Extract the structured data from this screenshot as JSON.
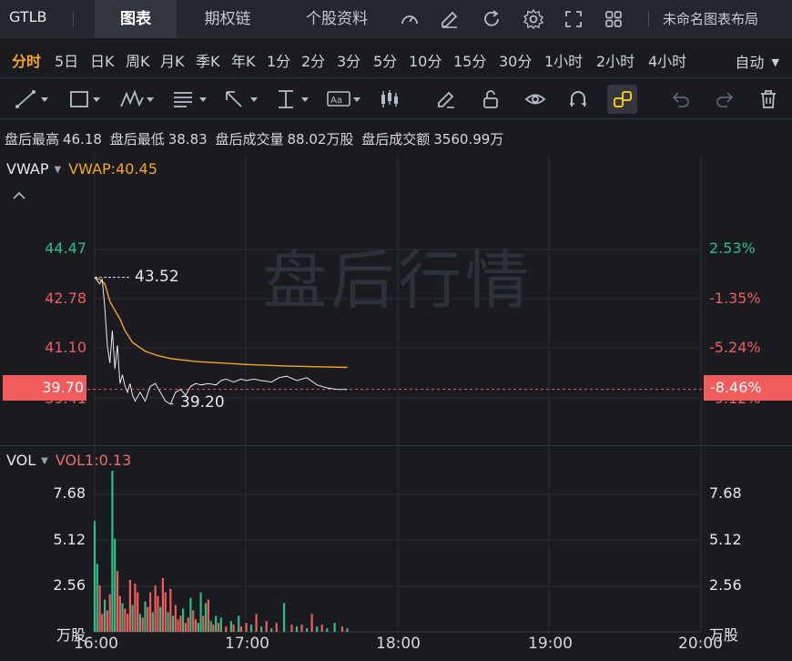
{
  "header": {
    "ticker": "GTLB",
    "tabs": [
      "图表",
      "期权链",
      "个股资料"
    ],
    "layout_name": "未命名图表布局"
  },
  "periods": {
    "items": [
      "分时",
      "5日",
      "日K",
      "周K",
      "月K",
      "季K",
      "年K",
      "1分",
      "2分",
      "3分",
      "5分",
      "10分",
      "15分",
      "30分",
      "1小时",
      "2小时",
      "4小时"
    ],
    "active": "分时",
    "auto_label": "自动"
  },
  "info": {
    "high_label": "盘后最高",
    "high": "46.18",
    "low_label": "盘后最低",
    "low": "38.83",
    "vol_label": "盘后成交量",
    "vol": "88.02万股",
    "amt_label": "盘后成交额",
    "amt": "3560.99万"
  },
  "price_panel": {
    "indicator": "VWAP",
    "indicator_value": "VWAP:40.45",
    "watermark": "盘后行情",
    "left_ticks": [
      "44.47",
      "42.78",
      "41.10",
      "39.41"
    ],
    "right_ticks": [
      "2.53%",
      "-1.35%",
      "-5.24%",
      "-9.12%"
    ],
    "current_price": "39.70",
    "current_pct": "-8.46%",
    "high_annotation": "43.52",
    "low_annotation": "39.20"
  },
  "volume_panel": {
    "indicator": "VOL",
    "indicator_value": "VOL1:0.13",
    "ticks": [
      "7.68",
      "5.12",
      "2.56"
    ],
    "unit": "万股"
  },
  "x_axis": {
    "labels": [
      "16:00",
      "17:00",
      "18:00",
      "19:00",
      "20:00"
    ]
  },
  "colors": {
    "up": "#2ebd85",
    "down": "#f05b5b",
    "vwap": "#f5a623",
    "accent": "#f5a623",
    "active_tool": "#f5c518"
  },
  "chart_data": [
    {
      "type": "line",
      "x_range": [
        "16:00",
        "20:00"
      ],
      "ylim": [
        38.9,
        45.8
      ],
      "series": [
        {
          "name": "VWAP",
          "x_minutes": [
            0,
            2,
            4,
            6,
            8,
            10,
            12,
            15,
            20,
            25,
            30,
            40,
            50,
            60,
            75,
            90,
            100
          ],
          "values": [
            43.5,
            43.45,
            43.3,
            42.7,
            42.4,
            42.1,
            41.7,
            41.3,
            41.0,
            40.85,
            40.75,
            40.65,
            40.6,
            40.55,
            40.5,
            40.47,
            40.45
          ]
        },
        {
          "name": "Price",
          "x_minutes": [
            0,
            2,
            3,
            4,
            5,
            6,
            7,
            8,
            9,
            10,
            11,
            12,
            13,
            14,
            15,
            16,
            18,
            20,
            22,
            24,
            26,
            28,
            30,
            32,
            34,
            36,
            38,
            40,
            42,
            45,
            48,
            50,
            52,
            55,
            58,
            60,
            63,
            66,
            70,
            73,
            76,
            80,
            84,
            88,
            92,
            96,
            100
          ],
          "values": [
            43.52,
            43.3,
            43.45,
            42.5,
            41.2,
            40.6,
            41.7,
            40.4,
            41.2,
            39.9,
            40.2,
            39.8,
            39.6,
            39.9,
            39.5,
            39.3,
            39.6,
            39.3,
            39.8,
            39.9,
            39.6,
            39.3,
            39.2,
            39.6,
            39.7,
            39.5,
            39.8,
            39.9,
            39.85,
            39.9,
            39.85,
            40.0,
            40.05,
            39.95,
            40.05,
            40.0,
            40.05,
            40.0,
            39.95,
            40.1,
            40.15,
            40.0,
            40.1,
            39.85,
            39.75,
            39.7,
            39.7
          ]
        }
      ]
    },
    {
      "type": "bar",
      "x_range": [
        "16:00",
        "20:00"
      ],
      "ylim": [
        0,
        9.6
      ],
      "unit": "万股",
      "x_minutes": [
        0,
        1,
        2,
        3,
        4,
        5,
        6,
        7,
        8,
        9,
        10,
        11,
        12,
        13,
        14,
        15,
        16,
        17,
        18,
        19,
        20,
        21,
        22,
        23,
        24,
        25,
        26,
        27,
        28,
        29,
        30,
        31,
        32,
        33,
        34,
        35,
        36,
        37,
        38,
        39,
        40,
        41,
        42,
        43,
        44,
        45,
        46,
        47,
        48,
        49,
        50,
        52,
        54,
        55,
        57,
        58,
        60,
        62,
        64,
        66,
        68,
        70,
        72,
        75,
        78,
        80,
        82,
        84,
        86,
        88,
        90,
        92,
        95,
        98,
        100
      ],
      "values": [
        6.2,
        3.8,
        2.6,
        1.0,
        1.8,
        1.2,
        2.1,
        9.0,
        5.2,
        3.4,
        2.0,
        1.6,
        1.3,
        1.0,
        2.9,
        1.5,
        2.7,
        2.2,
        1.0,
        0.8,
        1.7,
        1.4,
        2.2,
        1.1,
        2.6,
        2.0,
        1.4,
        3.0,
        2.2,
        1.1,
        2.4,
        0.9,
        1.5,
        0.7,
        0.9,
        1.3,
        0.5,
        0.8,
        1.9,
        1.2,
        0.7,
        0.5,
        2.2,
        0.9,
        1.6,
        1.8,
        0.6,
        0.4,
        0.9,
        0.5,
        0.8,
        0.3,
        0.6,
        0.4,
        0.9,
        0.3,
        0.5,
        0.4,
        1.0,
        0.3,
        0.6,
        0.2,
        0.5,
        1.6,
        0.4,
        0.3,
        0.4,
        0.2,
        1.0,
        0.3,
        0.4,
        0.2,
        0.5,
        0.3,
        0.2
      ],
      "directions": [
        "up",
        "up",
        "down",
        "down",
        "up",
        "down",
        "down",
        "up",
        "up",
        "down",
        "down",
        "up",
        "down",
        "down",
        "down",
        "up",
        "down",
        "down",
        "up",
        "down",
        "up",
        "down",
        "down",
        "up",
        "down",
        "down",
        "up",
        "down",
        "down",
        "up",
        "down",
        "up",
        "down",
        "down",
        "down",
        "up",
        "down",
        "down",
        "up",
        "down",
        "down",
        "up",
        "up",
        "down",
        "up",
        "down",
        "up",
        "down",
        "up",
        "down",
        "up",
        "down",
        "up",
        "down",
        "up",
        "down",
        "down",
        "up",
        "down",
        "up",
        "down",
        "up",
        "down",
        "up",
        "down",
        "up",
        "down",
        "up",
        "down",
        "up",
        "down",
        "up",
        "up",
        "down",
        "up"
      ]
    }
  ]
}
